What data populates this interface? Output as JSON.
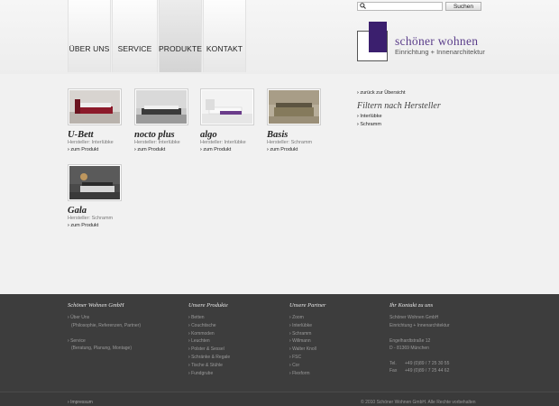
{
  "nav": {
    "items": [
      "ÜBER UNS",
      "SERVICE",
      "PRODUKTE",
      "KONTAKT"
    ]
  },
  "search": {
    "placeholder": "",
    "button_label": "Suchen"
  },
  "logo": {
    "name": "schöner wohnen",
    "subtitle": "Einrichtung + Innenarchitektur"
  },
  "products": [
    {
      "name": "U-Bett",
      "maker": "Hersteller: Interlübke",
      "link": "zum Produkt"
    },
    {
      "name": "nocto plus",
      "maker": "Hersteller: Interlübke",
      "link": "zum Produkt"
    },
    {
      "name": "algo",
      "maker": "Hersteller: Interlübke",
      "link": "zum Produkt"
    },
    {
      "name": "Basis",
      "maker": "Hersteller: Schramm",
      "link": "zum Produkt"
    },
    {
      "name": "Gala",
      "maker": "Hersteller: Schramm",
      "link": "zum Produkt"
    }
  ],
  "sidebar": {
    "back": "zurück zur Übersicht",
    "title": "Filtern nach Hersteller",
    "filters": [
      "Interlübke",
      "Schramm"
    ]
  },
  "footer": {
    "col1": {
      "title": "Schöner Wohnen GmbH",
      "items": [
        "Über Uns",
        "(Philosophie, Referenzen, Partner)",
        "Service",
        "(Beratung, Planung, Montage)"
      ]
    },
    "col2": {
      "title": "Unsere Produkte",
      "items": [
        "Betten",
        "Couchtische",
        "Kommoden",
        "Leuchten",
        "Polster & Sessel",
        "Schränke & Regale",
        "Tische & Stühle",
        "Fundgrube"
      ]
    },
    "col3": {
      "title": "Unsere Partner",
      "items": [
        "Zoom",
        "Interlübke",
        "Schramm",
        "Willmann",
        "Walter Knoll",
        "FSC",
        "Cor",
        "Flexform"
      ]
    },
    "col4": {
      "title": "Ihr Kontakt zu uns",
      "company": "Schöner Wohnen GmbH",
      "company_sub": "Einrichtung + Innenarchitektur",
      "street": "Engelhardtstraße 12",
      "city": "D - 81369 München",
      "tel_label": "Tel.",
      "tel": "+49 (0)89 / 7 25 30 55",
      "fax_label": "Fax",
      "fax": "+49 (0)89 / 7 25 44 62"
    },
    "impressum": "Impressum",
    "copyright": "© 2010 Schöner Wohnen GmbH. Alle Rechte vorbehalten"
  },
  "colors": {
    "brand_purple": "#3b1f6e",
    "footer_bg": "#3d3d3d"
  }
}
